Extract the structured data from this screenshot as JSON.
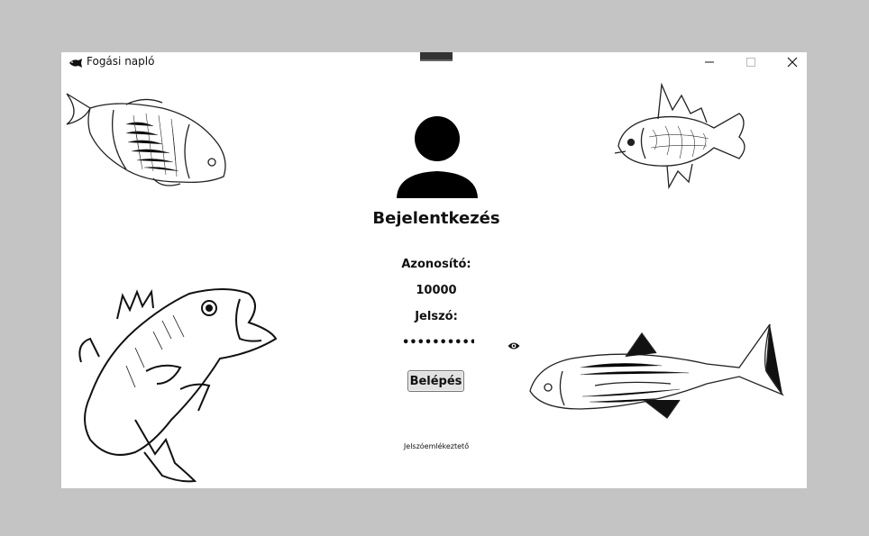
{
  "window": {
    "title": "Fogási napló",
    "icons": {
      "app": "fish-icon",
      "minimize": "minimize-icon",
      "maximize": "maximize-icon",
      "close": "close-icon"
    }
  },
  "login": {
    "title": "Bejelentkezés",
    "id_label": "Azonosító:",
    "id_value": "10000",
    "password_label": "Jelszó:",
    "password_value": "•••••••••••",
    "show_password_icon": "eye-icon",
    "login_button": "Belépés",
    "reminder_link": "Jelszóemlékeztető"
  },
  "decorations": [
    "carp-illustration",
    "perch-illustration",
    "bass-illustration",
    "mackerel-illustration"
  ],
  "colors": {
    "background": "#c4c4c4",
    "window": "#ffffff",
    "button": "#e1e1e1",
    "ink": "#111111"
  }
}
